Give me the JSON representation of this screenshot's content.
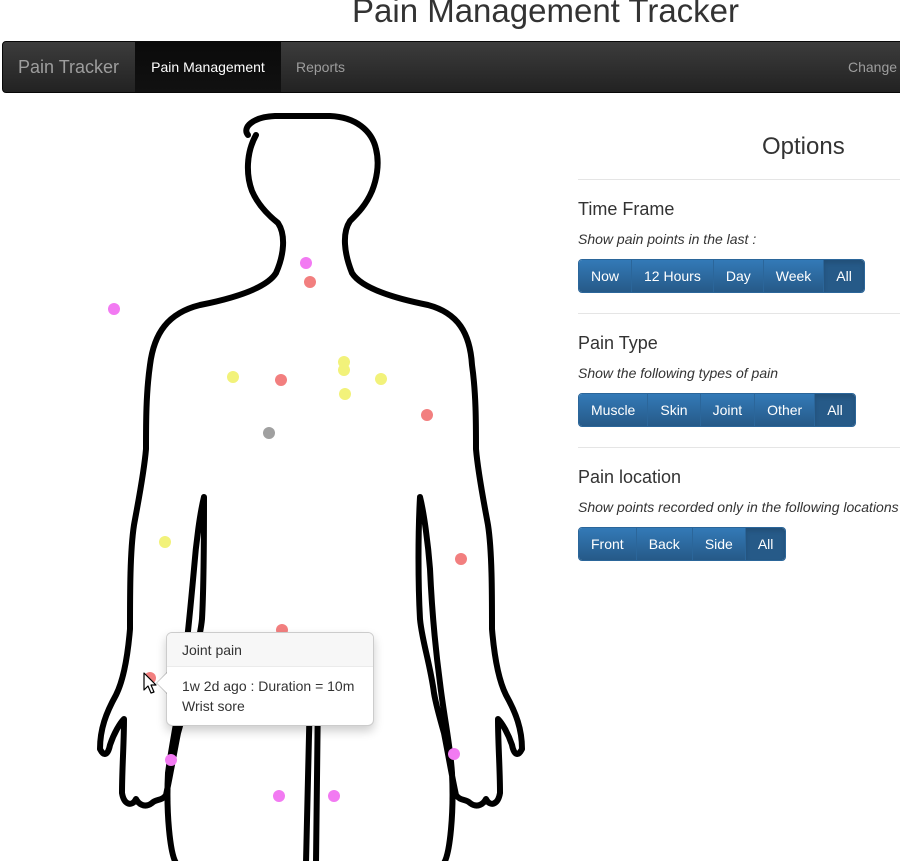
{
  "page": {
    "title": "Pain Management Tracker"
  },
  "navbar": {
    "brand": "Pain Tracker",
    "items": [
      {
        "label": "Pain Management",
        "active": true
      },
      {
        "label": "Reports",
        "active": false
      },
      {
        "label": "Change",
        "active": false
      }
    ]
  },
  "tooltip": {
    "title": "Joint pain",
    "line1": "1w 2d ago : Duration = 10m",
    "line2": "Wrist sore"
  },
  "colors": {
    "muscle": "#f27f7f",
    "skin": "#f2f27a",
    "joint": "#f27af2",
    "other": "#a0a0a0",
    "button": "#337ab7"
  },
  "options": {
    "title": "Options",
    "time_frame": {
      "title": "Time Frame",
      "desc": "Show pain points in the last :",
      "buttons": [
        "Now",
        "12 Hours",
        "Day",
        "Week",
        "All"
      ],
      "selected": "All"
    },
    "pain_type": {
      "title": "Pain Type",
      "desc": "Show the following types of pain",
      "buttons": [
        "Muscle",
        "Skin",
        "Joint",
        "Other",
        "All"
      ],
      "selected": "All"
    },
    "pain_location": {
      "title": "Pain location",
      "desc": "Show points recorded only in the following locations",
      "buttons": [
        "Front",
        "Back",
        "Side",
        "All"
      ],
      "selected": "All"
    }
  }
}
